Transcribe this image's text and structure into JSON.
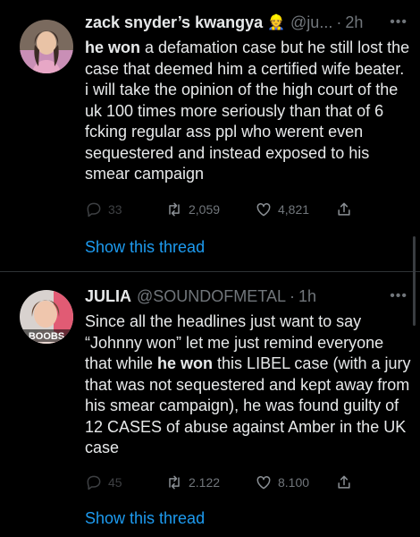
{
  "tweets": [
    {
      "name": "zack snyder’s kwangya",
      "emoji": "👷",
      "handle": "@ju...",
      "separator": "·",
      "time": "2h",
      "text_runs": [
        {
          "t": "he won",
          "bold": true
        },
        {
          "t": " a defamation case but he still lost the case that deemed him a certified wife beater. i will take the opinion of the high court of the uk 100 times more seriously than that of 6 fcking regular ass ppl who werent even sequestered and instead exposed to his smear campaign",
          "bold": false
        }
      ],
      "replies": "33",
      "retweets": "2,059",
      "likes": "4,821",
      "show_thread": "Show this thread"
    },
    {
      "name": "JULIA",
      "handle": "@SOUNDOFMETAL",
      "separator": "·",
      "time": "1h",
      "avatar_text": "BOOBS",
      "text_runs": [
        {
          "t": "Since all the headlines just want to say “Johnny won” let me just remind everyone that while ",
          "bold": false
        },
        {
          "t": "he won",
          "bold": true
        },
        {
          "t": " this LIBEL case (with a jury that was not sequestered and kept away from his smear campaign), he was found guilty of 12 CASES of abuse against Amber in the UK case",
          "bold": false
        }
      ],
      "replies": "45",
      "retweets": "2.122",
      "likes": "8.100",
      "show_thread": "Show this thread"
    }
  ],
  "colors": {
    "background": "#000000",
    "text": "#e7e9ea",
    "muted": "#71767b",
    "link": "#1d9bf0",
    "divider": "#2f3336"
  },
  "icons": [
    "reply-icon",
    "retweet-icon",
    "like-icon",
    "share-icon",
    "more-icon"
  ]
}
